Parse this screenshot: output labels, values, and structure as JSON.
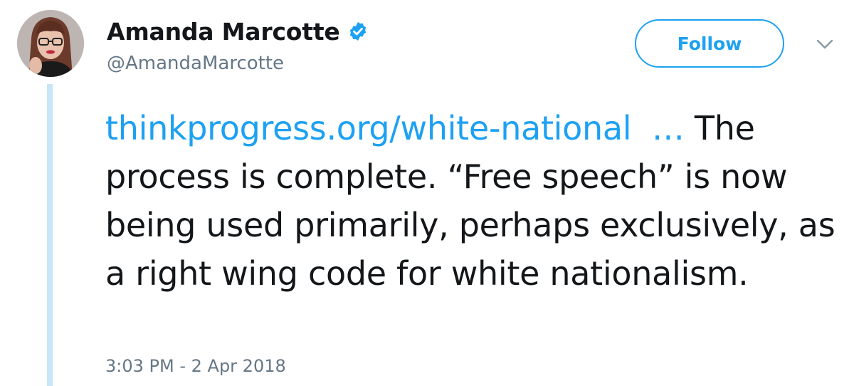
{
  "tweet": {
    "author": {
      "display_name": "Amanda Marcotte",
      "handle": "@AmandaMarcotte",
      "verified": true
    },
    "follow_label": "Follow",
    "text": {
      "link": "thinkprogress.org/white-national",
      "link_ellipsis": "…",
      "body_first": " The process is complete. “Free speech” is now being used primarily, perhaps exclusively, as a right wing code for white nationalism."
    },
    "timestamp": "3:03 PM - 2 Apr 2018"
  },
  "colors": {
    "accent": "#1da1f2",
    "secondary_text": "#657786",
    "thread_line": "#c8e6f7",
    "primary_text": "#14171a"
  }
}
